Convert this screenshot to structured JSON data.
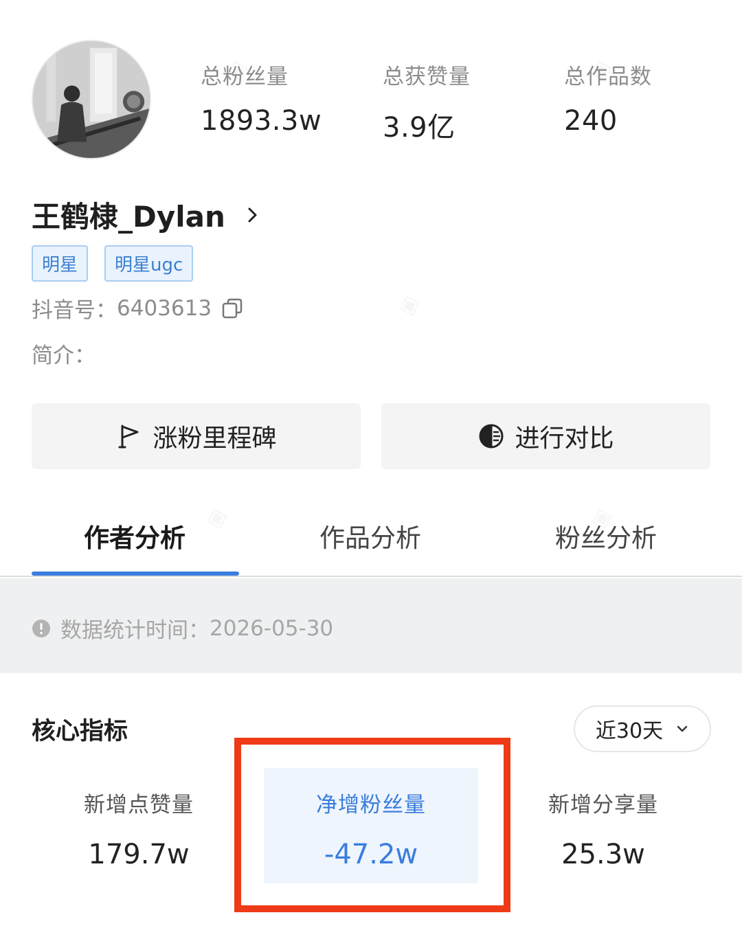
{
  "profile": {
    "avatar_icon": "user-photo",
    "name": "王鹤棣_Dylan",
    "tags": [
      "明星",
      "明星ugc"
    ],
    "account_label": "抖音号：",
    "account_id": "6403613",
    "bio_label": "简介："
  },
  "stats": [
    {
      "label": "总粉丝量",
      "value": "1893.3w"
    },
    {
      "label": "总获赞量",
      "value": "3.9亿"
    },
    {
      "label": "总作品数",
      "value": "240"
    }
  ],
  "actions": {
    "milestone_label": "涨粉里程碑",
    "milestone_icon": "flag-icon",
    "compare_label": "进行对比",
    "compare_icon": "compare-icon"
  },
  "tabs": [
    {
      "label": "作者分析",
      "active": true
    },
    {
      "label": "作品分析",
      "active": false
    },
    {
      "label": "粉丝分析",
      "active": false
    }
  ],
  "info": {
    "stat_time_label": "数据统计时间：",
    "stat_time_value": "2026-05-30"
  },
  "core": {
    "title": "核心指标",
    "period": "近30天",
    "metrics": [
      {
        "label": "新增点赞量",
        "value": "179.7w"
      },
      {
        "label": "净增粉丝量",
        "value": "-47.2w",
        "highlighted": true
      },
      {
        "label": "新增分享量",
        "value": "25.3w"
      }
    ]
  },
  "colors": {
    "accent": "#3b7ddd",
    "highlight_box": "#ee3a17",
    "tag_text": "#3a7fd0"
  }
}
